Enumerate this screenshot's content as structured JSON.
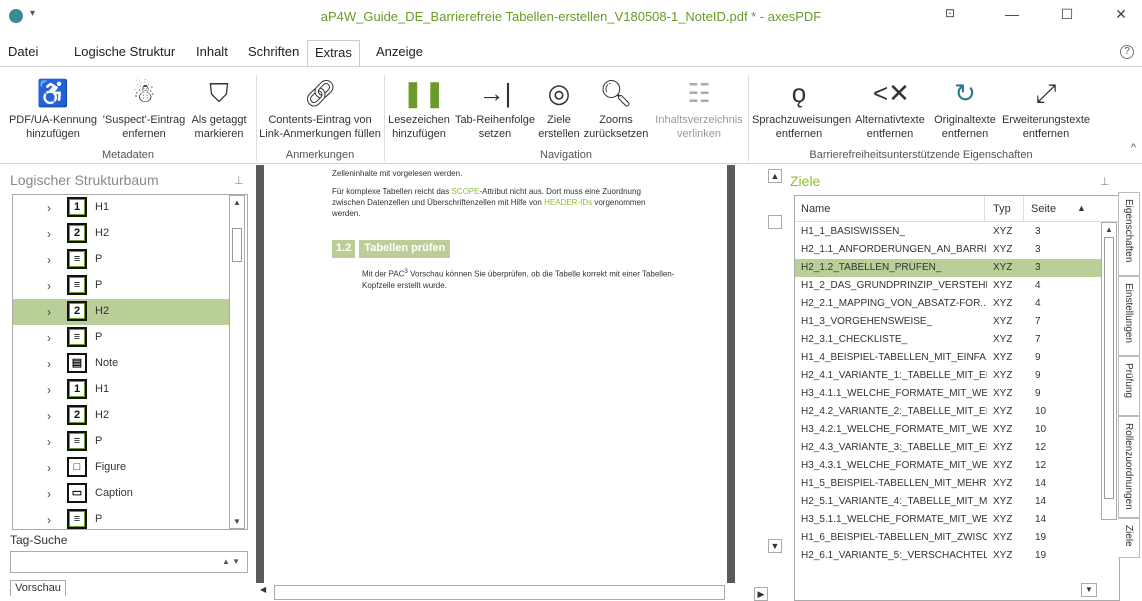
{
  "window": {
    "title": "aP4W_Guide_DE_Barrierefreie Tabellen-erstellen_V180508-1_NoteID.pdf * - axesPDF",
    "minimize": "—",
    "maximize": "☐",
    "close": "✕",
    "restore": "⊡"
  },
  "menu": [
    "Datei",
    "Logische Struktur",
    "Inhalt",
    "Schriften",
    "Extras",
    "Anzeige"
  ],
  "ribbon": {
    "metadaten": {
      "label": "Metadaten",
      "b1": [
        "PDF/UA-Kennung",
        "hinzufügen"
      ],
      "b2": [
        "'Suspect'-Eintrag",
        "enfernen"
      ],
      "b3": [
        "Als getaggt",
        "markieren"
      ]
    },
    "anmerkungen": {
      "label": "Anmerkungen",
      "b1": [
        "Contents-Eintrag von",
        "Link-Anmerkungen füllen"
      ]
    },
    "navigation": {
      "label": "Navigation",
      "b1": [
        "Lesezeichen",
        "hinzufügen"
      ],
      "b2": [
        "Tab-Reihenfolge",
        "setzen"
      ],
      "b3": [
        "Ziele",
        "erstellen"
      ],
      "b4": [
        "Zooms",
        "zurücksetzen"
      ],
      "b5": [
        "Inhaltsverzeichnis",
        "verlinken"
      ]
    },
    "barriere": {
      "label": "Barrierefreiheitsunterstützende Eigenschaften",
      "b1": [
        "Sprachzuweisungen",
        "entfernen"
      ],
      "b2": [
        "Alternativtexte",
        "entfernen"
      ],
      "b3": [
        "Originaltexte",
        "entfernen"
      ],
      "b4": [
        "Erweiterungstexte",
        "entfernen"
      ]
    }
  },
  "left_panel": {
    "title": "Logischer Strukturbaum",
    "items": [
      {
        "icon": "1",
        "label": "H1"
      },
      {
        "icon": "2",
        "label": "H2"
      },
      {
        "icon": "≡",
        "label": "P"
      },
      {
        "icon": "≡",
        "label": "P"
      },
      {
        "icon": "2",
        "label": "H2",
        "selected": true
      },
      {
        "icon": "≡",
        "label": "P"
      },
      {
        "icon": "▤",
        "label": "Note"
      },
      {
        "icon": "1",
        "label": "H1"
      },
      {
        "icon": "2",
        "label": "H2"
      },
      {
        "icon": "≡",
        "label": "P"
      },
      {
        "icon": "□",
        "label": "Figure"
      },
      {
        "icon": "▭",
        "label": "Caption"
      },
      {
        "icon": "≡",
        "label": "P"
      }
    ],
    "tag_search_label": "Tag-Suche",
    "tag_search_value": ""
  },
  "document": {
    "line1": "Zelleninhalte mit vorgelesen werden.",
    "para2_a": "Für komplexe Tabellen reicht das ",
    "para2_scope": "SCOPE",
    "para2_b": "-Attribut nicht aus. Dort muss eine Zuordnung",
    "para2_c": "zwischen Datenzellen und Überschriftenzellen mit Hilfe von ",
    "para2_header": "HEADER-IDs",
    "para2_d": " vorgenommen",
    "para2_e": "werden.",
    "heading_num": "1.2",
    "heading_text": "Tabellen prüfen",
    "para3_a": "Mit der PAC",
    "para3_sup": "3",
    "para3_b": " Vorschau können Sie überprüfen, ob die Tabelle korrekt mit einer Tabellen-",
    "para3_c": "Kopfzeile erstellt wurde."
  },
  "right_panel": {
    "title": "Ziele",
    "columns": [
      "Name",
      "Typ",
      "Seite"
    ],
    "sort_arrow": "▲",
    "rows": [
      {
        "name": "H1_1_BASISWISSEN_",
        "typ": "XYZ",
        "seite": "3"
      },
      {
        "name": "H2_1.1_ANFORDERUNGEN_AN_BARRI...",
        "typ": "XYZ",
        "seite": "3"
      },
      {
        "name": "H2_1.2_TABELLEN_PRÜFEN_",
        "typ": "XYZ",
        "seite": "3",
        "selected": true
      },
      {
        "name": "H1_2_DAS_GRUNDPRINZIP_VERSTEHE...",
        "typ": "XYZ",
        "seite": "4"
      },
      {
        "name": "H2_2.1_MAPPING_VON_ABSATZ-FOR...",
        "typ": "XYZ",
        "seite": "4"
      },
      {
        "name": "H1_3_VORGEHENSWEISE_",
        "typ": "XYZ",
        "seite": "7"
      },
      {
        "name": "H2_3.1_CHECKLISTE_",
        "typ": "XYZ",
        "seite": "7"
      },
      {
        "name": "H1_4_BEISPIEL-TABELLEN_MIT_EINFA...",
        "typ": "XYZ",
        "seite": "9"
      },
      {
        "name": "H2_4.1_VARIANTE_1:_TABELLE_MIT_EI...",
        "typ": "XYZ",
        "seite": "9"
      },
      {
        "name": "H3_4.1.1_WELCHE_FORMATE_MIT_WE...",
        "typ": "XYZ",
        "seite": "9"
      },
      {
        "name": "H2_4.2_VARIANTE_2:_TABELLE_MIT_EI...",
        "typ": "XYZ",
        "seite": "10"
      },
      {
        "name": "H3_4.2.1_WELCHE_FORMATE_MIT_WE...",
        "typ": "XYZ",
        "seite": "10"
      },
      {
        "name": "H2_4.3_VARIANTE_3:_TABELLE_MIT_EI...",
        "typ": "XYZ",
        "seite": "12"
      },
      {
        "name": "H3_4.3.1_WELCHE_FORMATE_MIT_WE...",
        "typ": "XYZ",
        "seite": "12"
      },
      {
        "name": "H1_5_BEISPIEL-TABELLEN_MIT_MEHRE...",
        "typ": "XYZ",
        "seite": "14"
      },
      {
        "name": "H2_5.1_VARIANTE_4:_TABELLE_MIT_M...",
        "typ": "XYZ",
        "seite": "14"
      },
      {
        "name": "H3_5.1.1_WELCHE_FORMATE_MIT_WE...",
        "typ": "XYZ",
        "seite": "14"
      },
      {
        "name": "H1_6_BEISPIEL-TABELLEN_MIT_ZWISC...",
        "typ": "XYZ",
        "seite": "19"
      },
      {
        "name": "H2_6.1_VARIANTE_5:_VERSCHACHTEL...",
        "typ": "XYZ",
        "seite": "19"
      }
    ]
  },
  "side_tabs": [
    "Eigenschaften",
    "Einstellungen",
    "Prüfung",
    "Rollenzuordnungen",
    "Ziele"
  ],
  "bottom_tab": "Vorschau",
  "colors": {
    "accent": "#8fbf30",
    "selection": "#b9cf97",
    "title": "#6a9a2a"
  }
}
